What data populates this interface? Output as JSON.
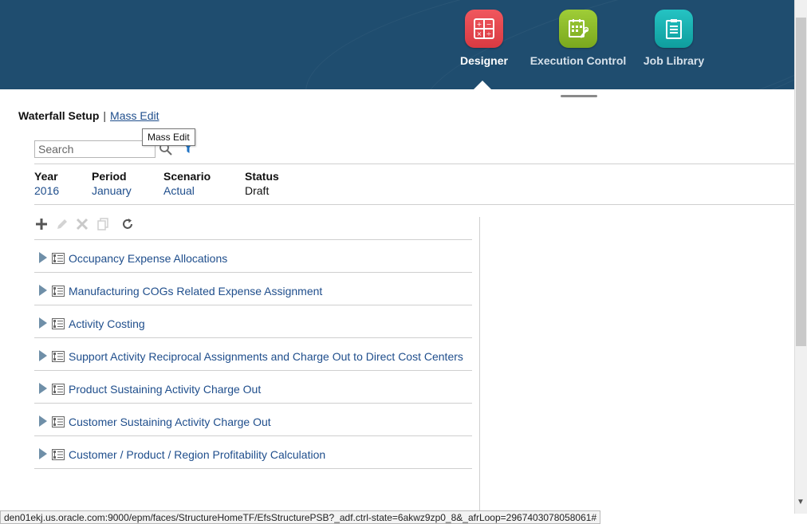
{
  "header": {
    "nav": [
      {
        "label": "Designer",
        "icon": "designer-calculator-icon",
        "color": "#e8474f",
        "active": true
      },
      {
        "label": "Execution Control",
        "icon": "execution-control-icon",
        "color": "#8cbb2a",
        "active": false
      },
      {
        "label": "Job Library",
        "icon": "job-library-clipboard-icon",
        "color": "#17b3b3",
        "active": false
      }
    ]
  },
  "breadcrumb": {
    "title": "Waterfall Setup",
    "separator": "|",
    "link": "Mass Edit"
  },
  "tooltip": {
    "text": "Mass Edit"
  },
  "search": {
    "placeholder": "Search",
    "value": ""
  },
  "pov": {
    "year": {
      "label": "Year",
      "value": "2016"
    },
    "period": {
      "label": "Period",
      "value": "January"
    },
    "scenario": {
      "label": "Scenario",
      "value": "Actual"
    },
    "status": {
      "label": "Status",
      "value": "Draft"
    }
  },
  "toolbar": {
    "buttons": [
      {
        "name": "add-icon",
        "enabled": true
      },
      {
        "name": "edit-icon",
        "enabled": false
      },
      {
        "name": "delete-icon",
        "enabled": false
      },
      {
        "name": "duplicate-icon",
        "enabled": false
      },
      {
        "name": "refresh-icon",
        "enabled": true
      }
    ]
  },
  "tree": {
    "items": [
      {
        "label": "Occupancy Expense Allocations"
      },
      {
        "label": "Manufacturing COGs Related Expense Assignment"
      },
      {
        "label": "Activity Costing"
      },
      {
        "label": "Support Activity Reciprocal Assignments and Charge Out to Direct Cost Centers"
      },
      {
        "label": "Product Sustaining Activity Charge Out"
      },
      {
        "label": "Customer Sustaining Activity Charge Out"
      },
      {
        "label": "Customer / Product / Region Profitability Calculation"
      }
    ]
  },
  "statusbar": {
    "url": "den01ekj.us.oracle.com:9000/epm/faces/StructureHomeTF/EfsStructurePSB?_adf.ctrl-state=6akwz9zp0_8&_afrLoop=2967403078058061#"
  },
  "colors": {
    "header_bg": "#1f4d6f",
    "link": "#1f4e8c"
  }
}
